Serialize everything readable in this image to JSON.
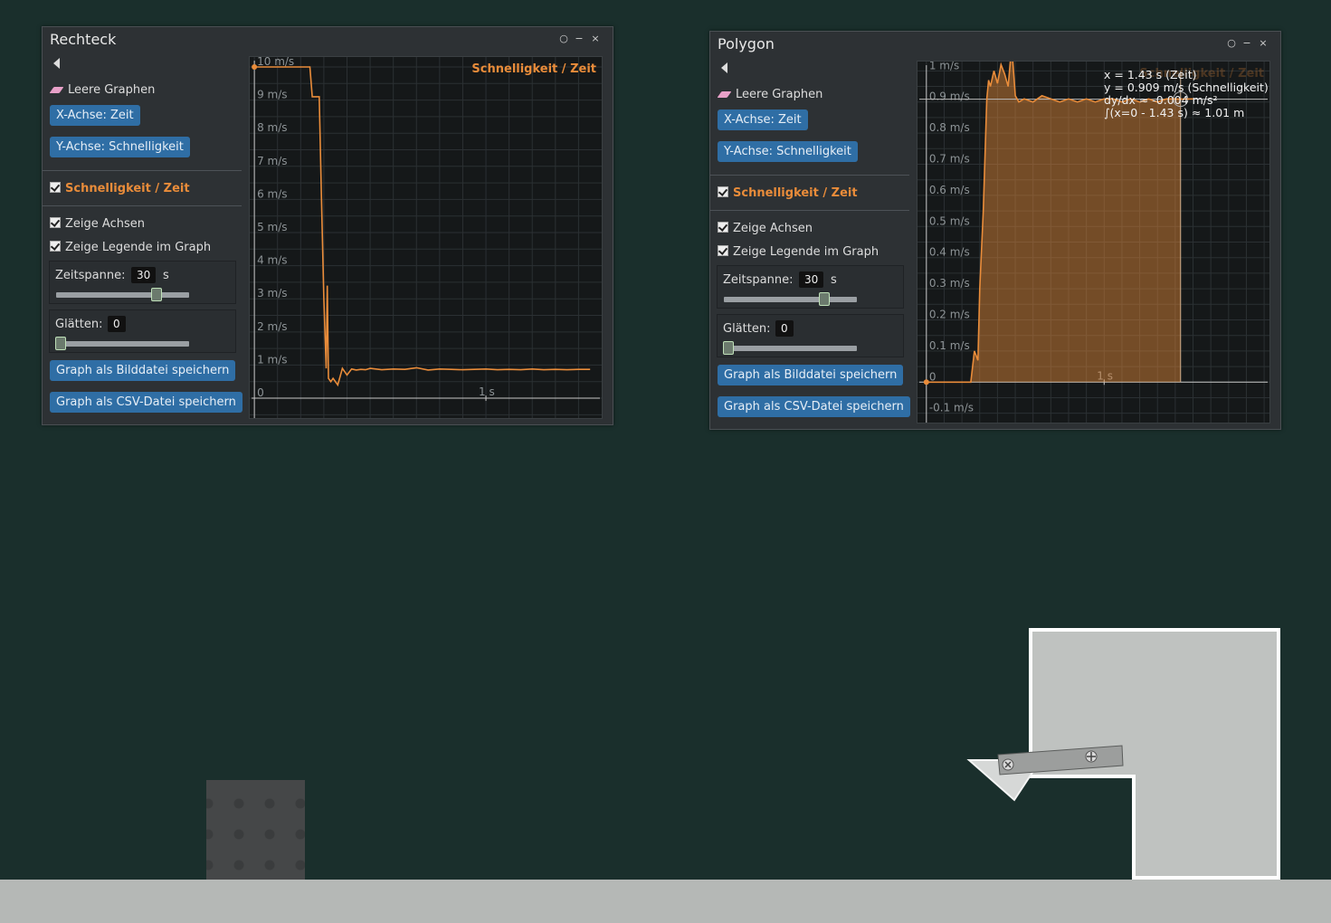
{
  "windows": [
    {
      "title": "Rechteck",
      "controls": {
        "pin": "pin-icon",
        "minimize": "−",
        "close": "×"
      },
      "clear_label": "Leere Graphen",
      "x_axis_button": "X-Achse: Zeit",
      "y_axis_button": "Y-Achse: Schnelligkeit",
      "series_label": "Schnelligkeit / Zeit",
      "show_axes_label": "Zeige Achsen",
      "show_legend_label": "Zeige Legende im Graph",
      "timespan_label": "Zeitspanne:",
      "timespan_value": "30",
      "timespan_unit": "s",
      "timespan_slider": 0.73,
      "smoothing_label": "Glätten:",
      "smoothing_value": "0",
      "smoothing_slider": 0,
      "save_image_button": "Graph als Bilddatei speichern",
      "save_csv_button": "Graph als CSV-Datei speichern",
      "legend": "Schnelligkeit / Zeit"
    },
    {
      "title": "Polygon",
      "controls": {
        "pin": "pin-icon",
        "minimize": "−",
        "close": "×"
      },
      "clear_label": "Leere Graphen",
      "x_axis_button": "X-Achse: Zeit",
      "y_axis_button": "Y-Achse: Schnelligkeit",
      "series_label": "Schnelligkeit / Zeit",
      "show_axes_label": "Zeige Achsen",
      "show_legend_label": "Zeige Legende im Graph",
      "timespan_label": "Zeitspanne:",
      "timespan_value": "30",
      "timespan_unit": "s",
      "timespan_slider": 0.73,
      "smoothing_label": "Glätten:",
      "smoothing_value": "0",
      "smoothing_slider": 0,
      "save_image_button": "Graph als Bilddatei speichern",
      "save_csv_button": "Graph als CSV-Datei speichern",
      "legend": "Schnelligkeit / Zeit",
      "hover_info": [
        "x = 1.43 s (Zeit)",
        "y = 0.909 m/s (Schnelligkeit)",
        "dy/dx ≈ -0.004 m/s²",
        "∫(x=0 - 1.43 s) ≈ 1.01 m"
      ]
    }
  ],
  "colors": {
    "series": "#e98c3a",
    "button": "#2f6ea5",
    "background": "#1a2f2c"
  },
  "chart_data": [
    {
      "type": "line",
      "title": "Schnelligkeit / Zeit",
      "xlabel": "",
      "ylabel": "",
      "x_unit": "s",
      "y_unit": "m/s",
      "xlim": [
        -0.02,
        1.5
      ],
      "ylim": [
        -0.6,
        10.3
      ],
      "y_ticks": [
        "0",
        "1 m/s",
        "2 m/s",
        "3 m/s",
        "4 m/s",
        "5 m/s",
        "6 m/s",
        "7 m/s",
        "8 m/s",
        "9 m/s",
        "10 m/s"
      ],
      "x_ticks": [
        "1 s"
      ],
      "grid": true,
      "legend": "top-right",
      "series": [
        {
          "x": [
            0,
            0.24,
            0.25,
            0.28,
            0.29,
            0.3,
            0.31,
            0.315,
            0.32,
            0.33,
            0.34,
            0.36,
            0.38,
            0.4,
            0.42,
            0.44,
            0.46,
            0.48,
            0.5,
            0.55,
            0.6,
            0.65,
            0.7,
            0.75,
            0.8,
            0.85,
            0.9,
            0.95,
            1.0,
            1.05,
            1.1,
            1.15,
            1.2,
            1.25,
            1.3,
            1.35,
            1.4,
            1.45
          ],
          "y": [
            10,
            10,
            9.1,
            9.1,
            6,
            3,
            0.9,
            3.4,
            0.6,
            0.5,
            0.6,
            0.4,
            0.9,
            0.7,
            0.88,
            0.85,
            0.87,
            0.86,
            0.9,
            0.86,
            0.88,
            0.87,
            0.92,
            0.85,
            0.88,
            0.87,
            0.86,
            0.87,
            0.88,
            0.86,
            0.87,
            0.86,
            0.88,
            0.86,
            0.87,
            0.86,
            0.87,
            0.87
          ]
        }
      ]
    },
    {
      "type": "area",
      "title": "Schnelligkeit / Zeit",
      "xlabel": "",
      "ylabel": "",
      "x_unit": "s",
      "y_unit": "m/s",
      "xlim": [
        -0.05,
        1.93
      ],
      "ylim": [
        -0.13,
        1.03
      ],
      "y_ticks": [
        "-0.1 m/s",
        "0",
        "0.1 m/s",
        "0.2 m/s",
        "0.3 m/s",
        "0.4 m/s",
        "0.5 m/s",
        "0.6 m/s",
        "0.7 m/s",
        "0.8 m/s",
        "0.9 m/s",
        "1 m/s"
      ],
      "x_ticks": [
        "1 s"
      ],
      "grid": true,
      "legend": "top-right",
      "integral_range": [
        0,
        1.43
      ],
      "hover_x": 1.43,
      "series": [
        {
          "x": [
            0,
            0.25,
            0.27,
            0.29,
            0.3,
            0.32,
            0.34,
            0.35,
            0.36,
            0.38,
            0.4,
            0.42,
            0.44,
            0.46,
            0.48,
            0.5,
            0.52,
            0.55,
            0.6,
            0.65,
            0.7,
            0.75,
            0.8,
            0.85,
            0.9,
            0.95,
            1.0,
            1.05,
            1.1,
            1.15,
            1.2,
            1.25,
            1.3,
            1.35,
            1.4,
            1.43,
            1.5
          ],
          "y": [
            0,
            0,
            0.1,
            0.07,
            0.3,
            0.55,
            0.91,
            0.97,
            0.95,
            1.0,
            0.96,
            1.02,
            0.99,
            0.95,
            1.08,
            0.92,
            0.9,
            0.91,
            0.9,
            0.92,
            0.91,
            0.9,
            0.91,
            0.9,
            0.91,
            0.9,
            0.91,
            0.91,
            0.9,
            0.91,
            0.9,
            0.91,
            0.9,
            0.91,
            0.91,
            0.909,
            0.91
          ]
        }
      ]
    }
  ]
}
